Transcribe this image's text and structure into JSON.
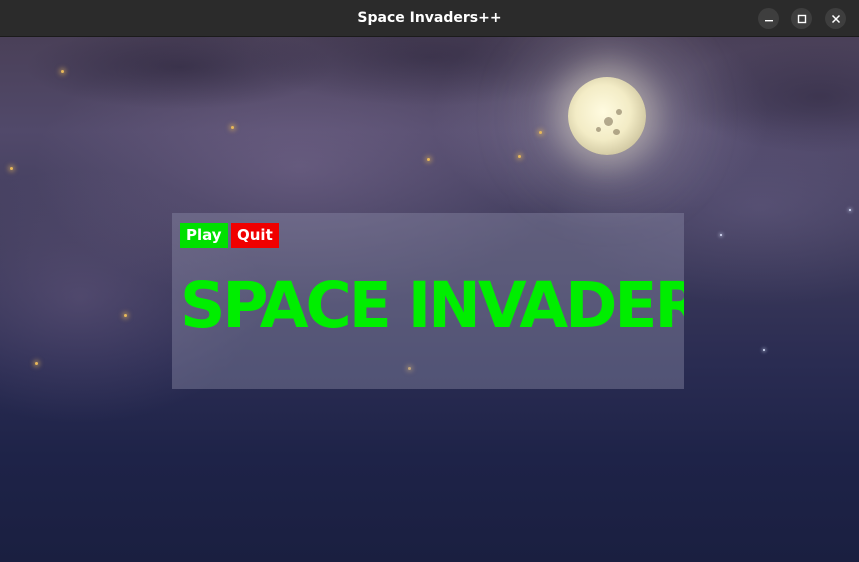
{
  "window": {
    "title": "Space Invaders++",
    "controls": {
      "minimize_icon": "minimize-icon",
      "maximize_icon": "maximize-icon",
      "close_icon": "close-icon"
    }
  },
  "menu": {
    "play_label": "Play",
    "quit_label": "Quit",
    "title": "SPACE INVADER",
    "colors": {
      "play": "#00e000",
      "quit": "#f00000",
      "title": "#00ee00"
    }
  }
}
